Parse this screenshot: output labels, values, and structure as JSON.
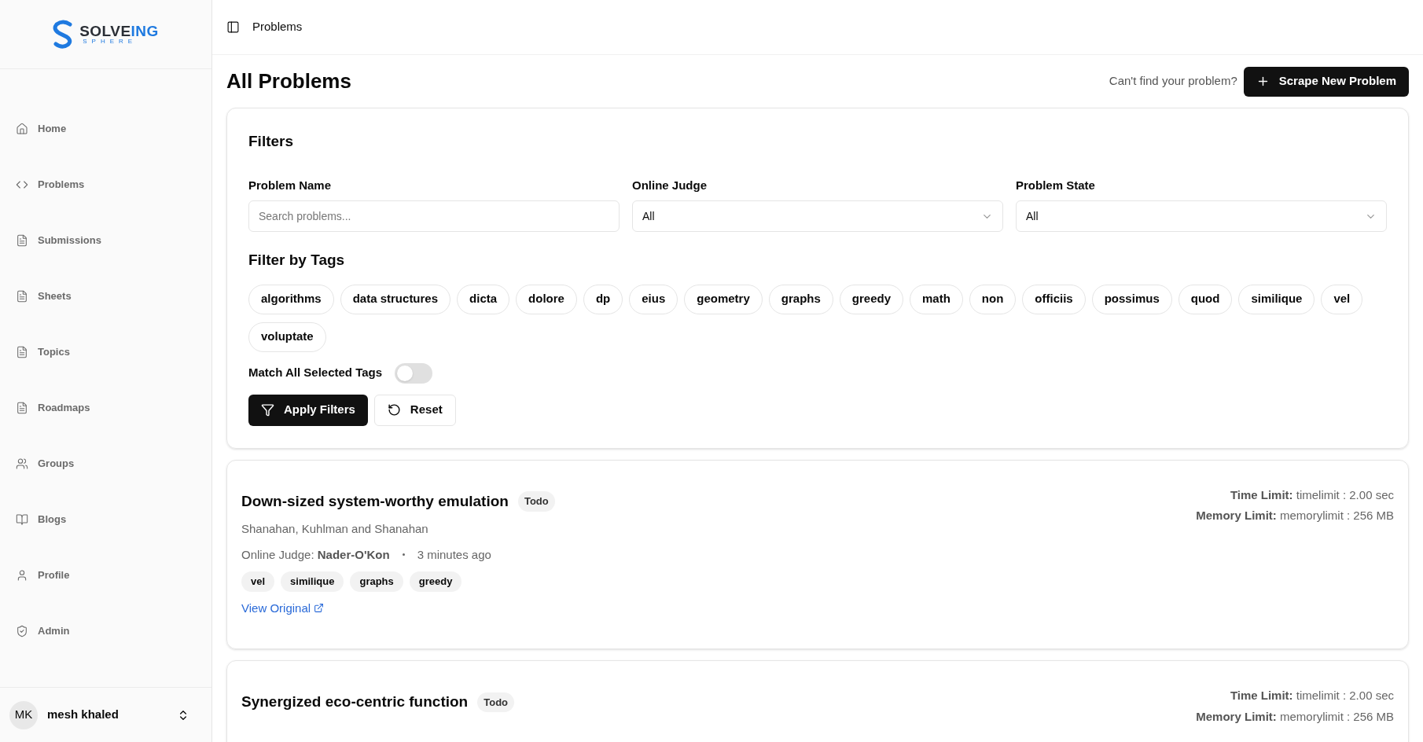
{
  "logo": {
    "word_dark": "SOLVE",
    "word_accent": "ING",
    "subtitle": "SPHERE"
  },
  "sidebar": {
    "items": [
      {
        "label": "Home",
        "kind": "home"
      },
      {
        "label": "Problems",
        "kind": "code"
      },
      {
        "label": "Submissions",
        "kind": "file"
      },
      {
        "label": "Sheets",
        "kind": "file"
      },
      {
        "label": "Topics",
        "kind": "file"
      },
      {
        "label": "Roadmaps",
        "kind": "file"
      },
      {
        "label": "Groups",
        "kind": "users"
      },
      {
        "label": "Blogs",
        "kind": "book"
      },
      {
        "label": "Profile",
        "kind": "user"
      },
      {
        "label": "Admin",
        "kind": "shield"
      }
    ],
    "user": {
      "initials": "MK",
      "name": "mesh khaled"
    }
  },
  "header": {
    "breadcrumb": "Problems"
  },
  "page": {
    "title": "All Problems",
    "hint": "Can't find your problem?",
    "action": "Scrape New Problem"
  },
  "filters": {
    "title": "Filters",
    "fields": [
      {
        "kind": "text",
        "label": "Problem Name",
        "placeholder": "Search problems..."
      },
      {
        "kind": "select",
        "label": "Online Judge",
        "value": "All"
      },
      {
        "kind": "select",
        "label": "Problem State",
        "value": "All"
      }
    ],
    "tags_title": "Filter by Tags",
    "tags": [
      "algorithms",
      "data structures",
      "dicta",
      "dolore",
      "dp",
      "eius",
      "geometry",
      "graphs",
      "greedy",
      "math",
      "non",
      "officiis",
      "possimus",
      "quod",
      "similique",
      "vel",
      "voluptate"
    ],
    "match_all": {
      "label": "Match All Selected Tags",
      "on": false
    },
    "apply": "Apply Filters",
    "reset": "Reset"
  },
  "problems": [
    {
      "title": "Down-sized system-worthy emulation",
      "status": "Todo",
      "source": "Shanahan, Kuhlman and Shanahan",
      "judge_label": "Online Judge:",
      "judge": "Nader-O'Kon",
      "time": "3 minutes ago",
      "tags": [
        "vel",
        "similique",
        "graphs",
        "greedy"
      ],
      "link": "View Original",
      "limits": [
        {
          "label": "Time Limit:",
          "value": "timelimit : 2.00 sec"
        },
        {
          "label": "Memory Limit:",
          "value": "memorylimit : 256 MB"
        }
      ]
    },
    {
      "title": "Synergized eco-centric function",
      "status": "Todo",
      "limits": [
        {
          "label": "Time Limit:",
          "value": "timelimit : 2.00 sec"
        },
        {
          "label": "Memory Limit:",
          "value": "memorylimit : 256 MB"
        }
      ]
    }
  ]
}
